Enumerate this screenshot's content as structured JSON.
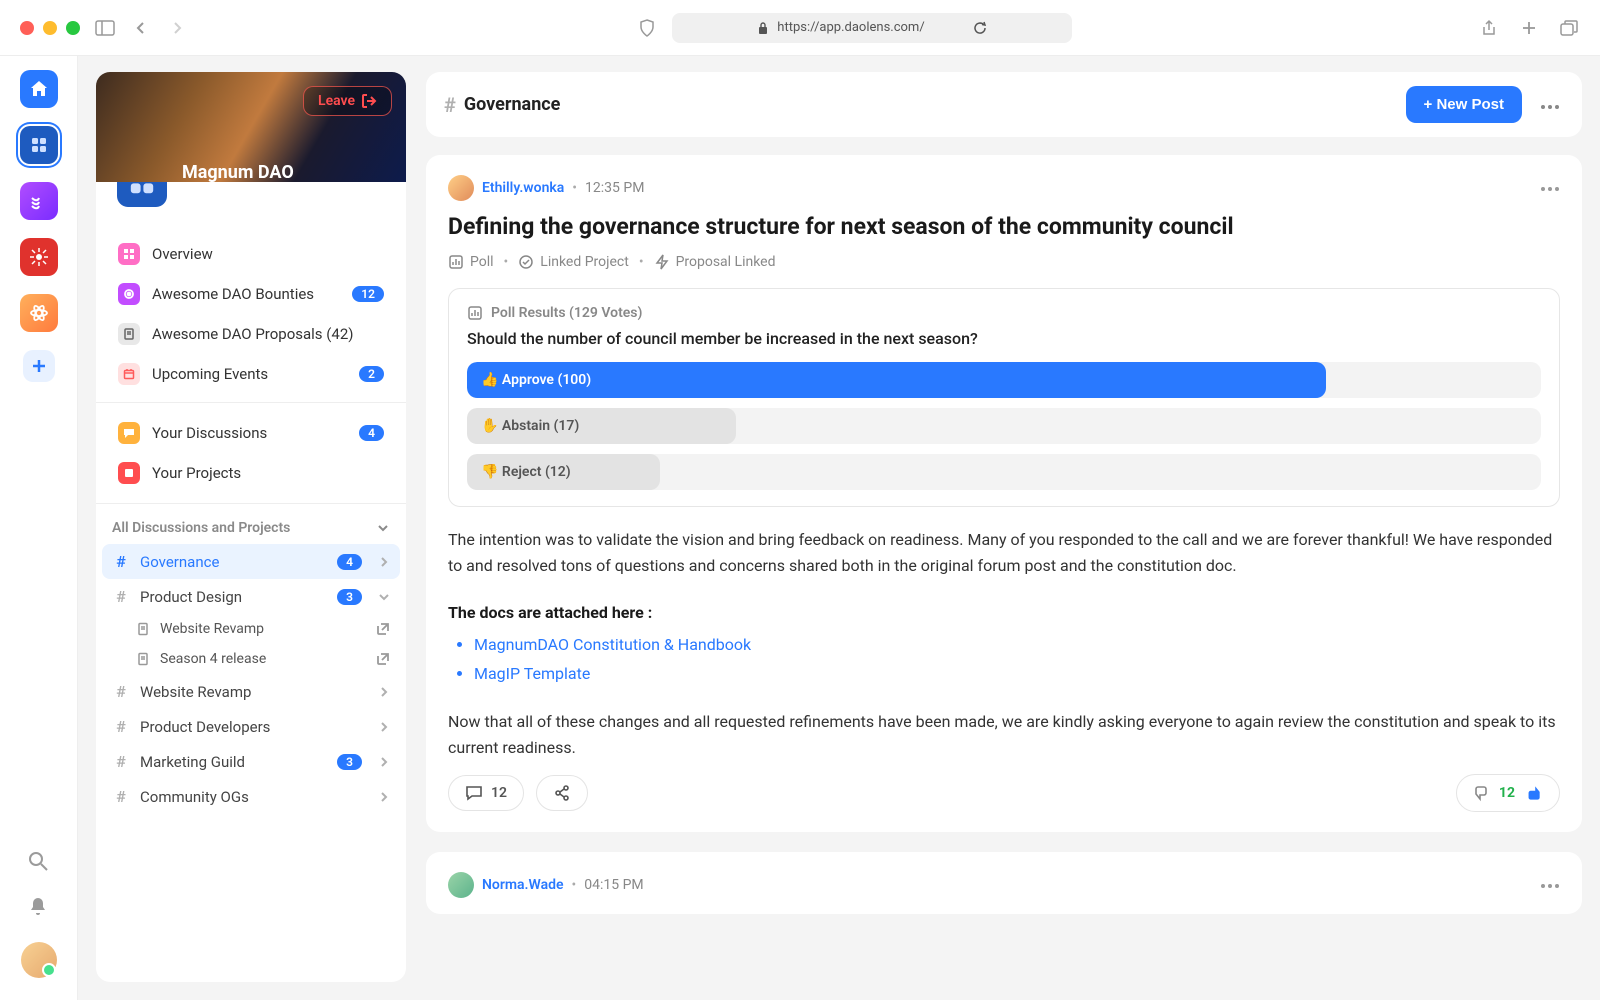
{
  "browser": {
    "url": "https://app.daolens.com/"
  },
  "rail": {
    "items": [
      {
        "name": "home",
        "bg": "#2979ff"
      },
      {
        "name": "workspace-magnum",
        "bg": "#1e5bbf",
        "active": true
      },
      {
        "name": "workspace-2",
        "bg": "#a93aff"
      },
      {
        "name": "workspace-3",
        "bg": "#e0322d"
      },
      {
        "name": "workspace-4",
        "bg": "#ff9f40"
      },
      {
        "name": "add",
        "bg": "#e8f1ff",
        "fg": "#2979ff"
      }
    ]
  },
  "dao": {
    "name": "Magnum DAO",
    "leave_label": "Leave"
  },
  "nav": {
    "overview": "Overview",
    "bounties": "Awesome DAO Bounties",
    "bounties_badge": "12",
    "proposals": "Awesome DAO Proposals (42)",
    "events": "Upcoming Events",
    "events_badge": "2",
    "discussions": "Your Discussions",
    "discussions_badge": "4",
    "projects": "Your Projects"
  },
  "channels": {
    "header": "All Discussions and Projects",
    "list": [
      {
        "label": "Governance",
        "badge": "4",
        "active": true
      },
      {
        "label": "Product Design",
        "badge": "3",
        "expanded": true
      },
      {
        "label": "Website Revamp"
      },
      {
        "label": "Product Developers"
      },
      {
        "label": "Marketing Guild",
        "badge": "3"
      },
      {
        "label": "Community OGs"
      }
    ],
    "subitems": [
      {
        "label": "Website Revamp"
      },
      {
        "label": "Season 4 release"
      }
    ]
  },
  "header": {
    "channel": "Governance",
    "new_post": "+ New Post"
  },
  "post": {
    "author": "Ethilly.wonka",
    "time": "12:35 PM",
    "title": "Defining the governance structure for next season of the community council",
    "meta_poll": "Poll",
    "meta_linked": "Linked Project",
    "meta_proposal": "Proposal Linked",
    "poll": {
      "results_label": "Poll Results (129 Votes)",
      "question": "Should the number of council member be increased in the next season?",
      "options": [
        {
          "emoji": "👍",
          "text": "Approve (100)",
          "pct": 80,
          "style": "blue"
        },
        {
          "emoji": "✋",
          "text": "Abstain (17)",
          "pct": 25,
          "style": "gray"
        },
        {
          "emoji": "👎",
          "text": "Reject (12)",
          "pct": 18,
          "style": "gray"
        }
      ]
    },
    "body1": "The intention was to validate the vision and bring feedback on readiness. Many of you responded to the call and we are forever thankful! We have responded to and resolved tons of questions and concerns shared both in the original forum post and the constitution doc.",
    "docs_heading": "The docs are attached here :",
    "docs": [
      "MagnumDAO Constitution & Handbook",
      "MagIP Template"
    ],
    "body2": "Now that all of these changes and all requested refinements have been made, we are kindly asking everyone to again review the constitution and speak to its current readiness.",
    "comments": "12",
    "votes": "12"
  },
  "post2": {
    "author": "Norma.Wade",
    "time": "04:15 PM"
  }
}
